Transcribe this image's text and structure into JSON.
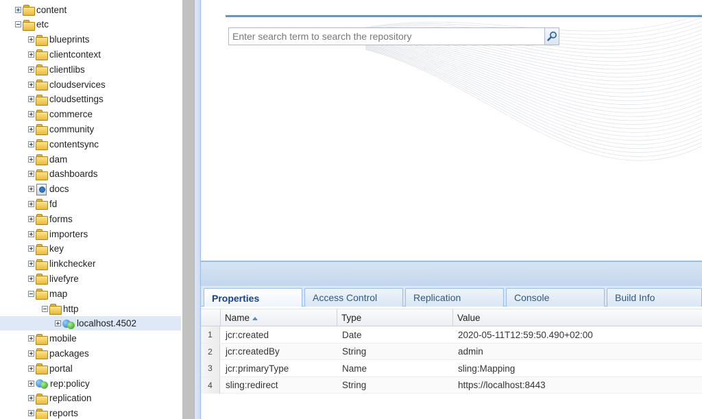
{
  "tree": {
    "items": [
      {
        "label": "content",
        "level": 0,
        "state": "collapsed",
        "icon": "folder-icon"
      },
      {
        "label": "etc",
        "level": 0,
        "state": "expanded",
        "icon": "folder-icon"
      },
      {
        "label": "blueprints",
        "level": 1,
        "state": "collapsed",
        "icon": "folder-icon"
      },
      {
        "label": "clientcontext",
        "level": 1,
        "state": "collapsed",
        "icon": "folder-icon"
      },
      {
        "label": "clientlibs",
        "level": 1,
        "state": "collapsed",
        "icon": "folder-icon"
      },
      {
        "label": "cloudservices",
        "level": 1,
        "state": "collapsed",
        "icon": "folder-icon"
      },
      {
        "label": "cloudsettings",
        "level": 1,
        "state": "collapsed",
        "icon": "folder-icon"
      },
      {
        "label": "commerce",
        "level": 1,
        "state": "collapsed",
        "icon": "folder-icon"
      },
      {
        "label": "community",
        "level": 1,
        "state": "collapsed",
        "icon": "folder-icon"
      },
      {
        "label": "contentsync",
        "level": 1,
        "state": "collapsed",
        "icon": "folder-icon"
      },
      {
        "label": "dam",
        "level": 1,
        "state": "collapsed",
        "icon": "folder-icon"
      },
      {
        "label": "dashboards",
        "level": 1,
        "state": "collapsed",
        "icon": "folder-icon"
      },
      {
        "label": "docs",
        "level": 1,
        "state": "collapsed",
        "icon": "docs-icon"
      },
      {
        "label": "fd",
        "level": 1,
        "state": "collapsed",
        "icon": "folder-icon"
      },
      {
        "label": "forms",
        "level": 1,
        "state": "collapsed",
        "icon": "folder-icon"
      },
      {
        "label": "importers",
        "level": 1,
        "state": "collapsed",
        "icon": "folder-icon"
      },
      {
        "label": "key",
        "level": 1,
        "state": "collapsed",
        "icon": "folder-icon"
      },
      {
        "label": "linkchecker",
        "level": 1,
        "state": "collapsed",
        "icon": "folder-icon"
      },
      {
        "label": "livefyre",
        "level": 1,
        "state": "collapsed",
        "icon": "folder-icon"
      },
      {
        "label": "map",
        "level": 1,
        "state": "expanded",
        "icon": "folder-icon"
      },
      {
        "label": "http",
        "level": 2,
        "state": "expanded",
        "icon": "folder-icon"
      },
      {
        "label": "localhost.4502",
        "level": 3,
        "state": "collapsed",
        "icon": "mapping-icon",
        "selected": true
      },
      {
        "label": "mobile",
        "level": 1,
        "state": "collapsed",
        "icon": "folder-icon"
      },
      {
        "label": "packages",
        "level": 1,
        "state": "collapsed",
        "icon": "folder-icon"
      },
      {
        "label": "portal",
        "level": 1,
        "state": "collapsed",
        "icon": "folder-icon"
      },
      {
        "label": "rep:policy",
        "level": 1,
        "state": "collapsed",
        "icon": "mapping-icon"
      },
      {
        "label": "replication",
        "level": 1,
        "state": "collapsed",
        "icon": "folder-icon"
      },
      {
        "label": "reports",
        "level": 1,
        "state": "collapsed",
        "icon": "folder-icon"
      }
    ]
  },
  "search": {
    "placeholder": "Enter search term to search the repository",
    "value": ""
  },
  "tabs": [
    {
      "label": "Properties",
      "active": true
    },
    {
      "label": "Access Control",
      "active": false
    },
    {
      "label": "Replication",
      "active": false
    },
    {
      "label": "Console",
      "active": false
    },
    {
      "label": "Build Info",
      "active": false
    }
  ],
  "grid": {
    "columns": [
      {
        "label": "Name",
        "sort": "asc"
      },
      {
        "label": "Type"
      },
      {
        "label": "Value"
      }
    ],
    "rows": [
      {
        "num": "1",
        "name": "jcr:created",
        "type": "Date",
        "value": "2020-05-11T12:59:50.490+02:00"
      },
      {
        "num": "2",
        "name": "jcr:createdBy",
        "type": "String",
        "value": "admin"
      },
      {
        "num": "3",
        "name": "jcr:primaryType",
        "type": "Name",
        "value": "sling:Mapping"
      },
      {
        "num": "4",
        "name": "sling:redirect",
        "type": "String",
        "value": "https://localhost:8443"
      }
    ]
  },
  "colors": {
    "accent": "#15428b",
    "selection": "#dfe8f6",
    "border": "#99bbe8"
  }
}
